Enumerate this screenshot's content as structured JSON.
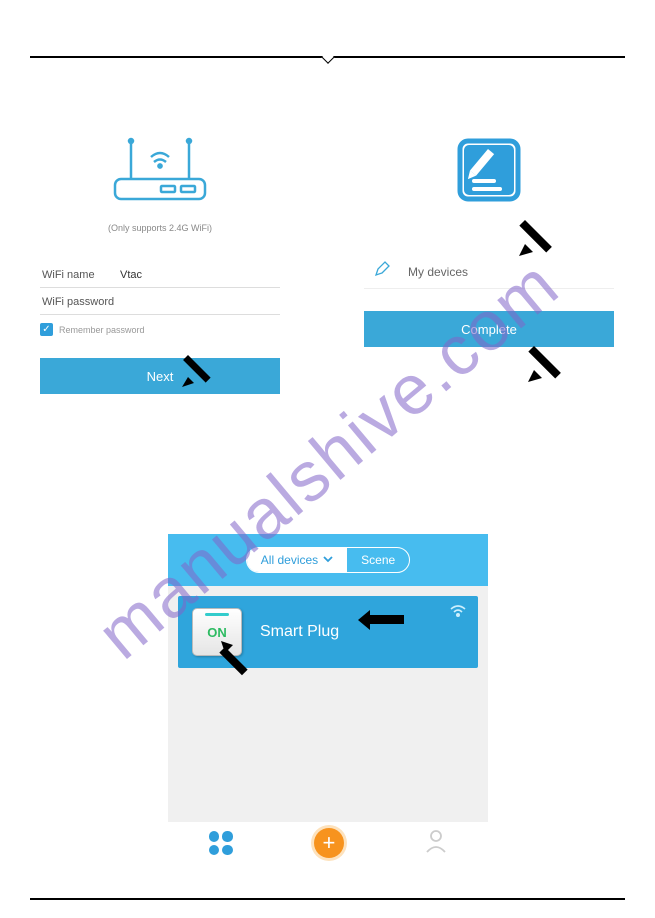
{
  "watermark": "manualshive.com",
  "left": {
    "note": "(Only supports 2.4G WiFi)",
    "wifi_name_label": "WiFi name",
    "wifi_name_value": "Vtac",
    "wifi_pass_label": "WiFi password",
    "wifi_pass_value": "",
    "remember_label": "Remember password",
    "button": "Next"
  },
  "right": {
    "device_label": "My devices",
    "button": "Complete"
  },
  "phone": {
    "tab_all": "All devices",
    "tab_scene": "Scene",
    "switch_state": "ON",
    "device_name": "Smart Plug"
  }
}
